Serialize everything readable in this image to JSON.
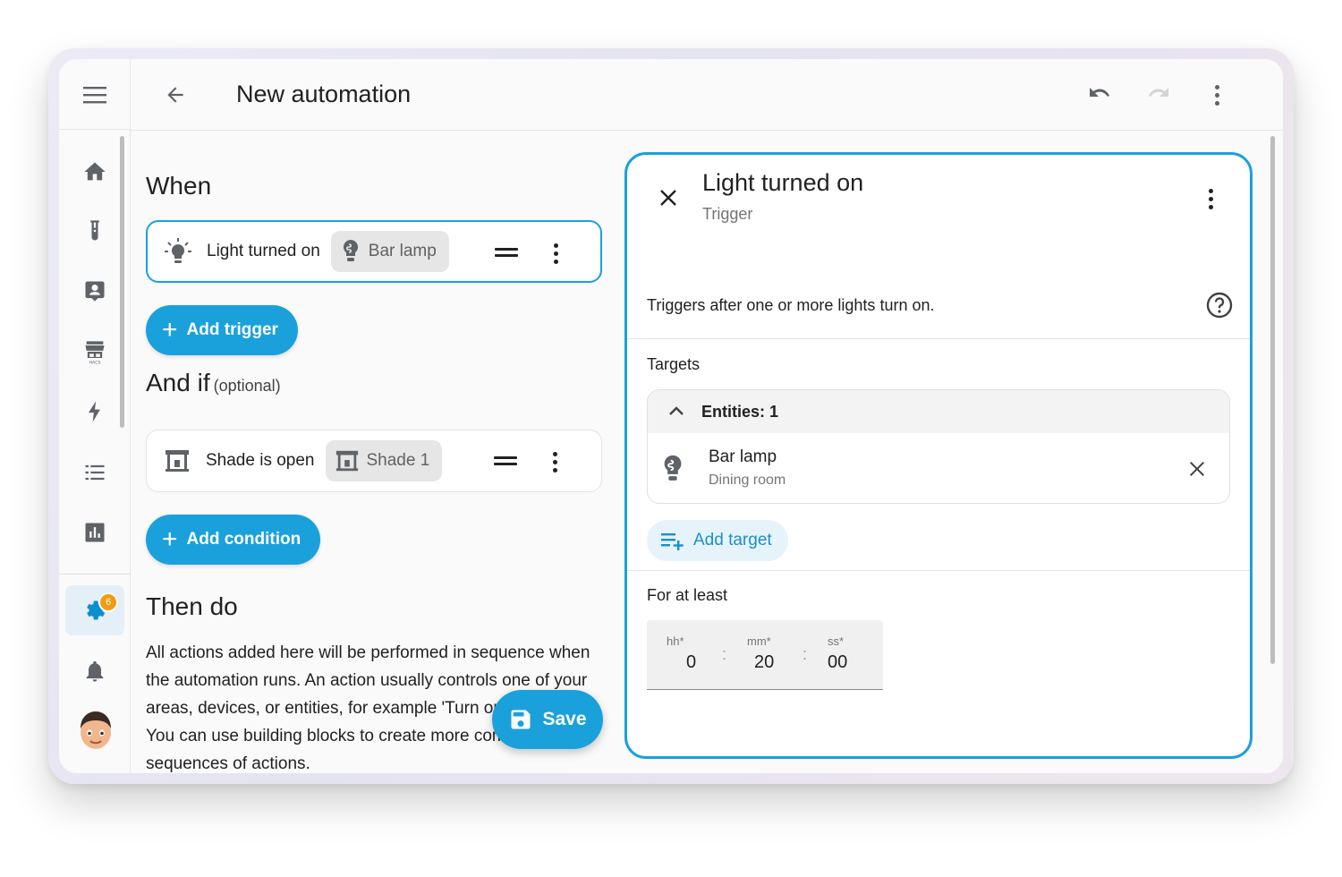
{
  "header": {
    "title": "New automation",
    "icons": [
      "menu-icon",
      "back-arrow-icon",
      "undo-icon",
      "redo-icon",
      "more-vertical-icon"
    ]
  },
  "sidebar": {
    "items": [
      {
        "name": "home",
        "icon": "home-icon"
      },
      {
        "name": "energy-tube",
        "icon": "test-tube-icon"
      },
      {
        "name": "person-card",
        "icon": "account-box-icon"
      },
      {
        "name": "hacs",
        "icon": "hacs-store-icon",
        "label": "HACS"
      },
      {
        "name": "energy",
        "icon": "lightning-bolt-icon"
      },
      {
        "name": "logbook",
        "icon": "format-list-icon"
      },
      {
        "name": "history",
        "icon": "bar-chart-icon"
      },
      {
        "name": "settings",
        "icon": "gear-icon",
        "badge": "6",
        "active": true
      },
      {
        "name": "notifications",
        "icon": "bell-icon"
      }
    ],
    "accent_color": "#0b8fcf",
    "badge_color": "#f39c12"
  },
  "when": {
    "title": "When",
    "trigger": {
      "label": "Light turned on",
      "entity": "Bar lamp"
    },
    "add_label": "Add trigger"
  },
  "and_if": {
    "title": "And if",
    "optional": "(optional)",
    "condition": {
      "label": "Shade is open",
      "entity": "Shade 1"
    },
    "add_label": "Add condition"
  },
  "then_do": {
    "title": "Then do",
    "description": "All actions added here will be performed in sequence when the automation runs. An action usually controls one of your areas, devices, or entities, for example 'Turn on the lights'. You can use building blocks to create more complex sequences of actions."
  },
  "save_label": "Save",
  "panel": {
    "title": "Light turned on",
    "subtitle": "Trigger",
    "description": "Triggers after one or more lights turn on.",
    "targets_label": "Targets",
    "entities_label": "Entities: 1",
    "entity": {
      "name": "Bar lamp",
      "area": "Dining room"
    },
    "add_target_label": "Add target",
    "for_at_least_label": "For at least",
    "duration": {
      "hours_label": "hh*",
      "hours": "0",
      "minutes_label": "mm*",
      "minutes": "20",
      "seconds_label": "ss*",
      "seconds": "00"
    }
  },
  "colors": {
    "primary": "#1aa1dc",
    "background": "#fafafa"
  }
}
